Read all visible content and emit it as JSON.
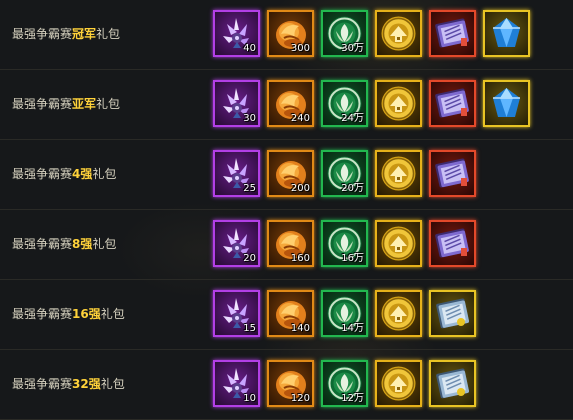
{
  "colors": {
    "label": "#d8d3c0",
    "highlight": "#ffd23a"
  },
  "icons": [
    "crystal-flower-icon",
    "fire-scroll-icon",
    "jade-coin-icon",
    "gold-coin-icon",
    "skill-book-icon",
    "sapphire-gem-icon"
  ],
  "rows": [
    {
      "label_prefix": "最强争霸赛",
      "label_highlight": "冠军",
      "label_suffix": "礼包",
      "items": [
        {
          "icon": "crystal-flower-icon",
          "qty": "40"
        },
        {
          "icon": "fire-scroll-icon",
          "qty": "300"
        },
        {
          "icon": "jade-coin-icon",
          "qty": "30万"
        },
        {
          "icon": "gold-coin-icon",
          "qty": ""
        },
        {
          "icon": "skill-book-icon",
          "qty": ""
        },
        {
          "icon": "sapphire-gem-icon",
          "qty": ""
        }
      ]
    },
    {
      "label_prefix": "最强争霸赛",
      "label_highlight": "亚军",
      "label_suffix": "礼包",
      "items": [
        {
          "icon": "crystal-flower-icon",
          "qty": "30"
        },
        {
          "icon": "fire-scroll-icon",
          "qty": "240"
        },
        {
          "icon": "jade-coin-icon",
          "qty": "24万"
        },
        {
          "icon": "gold-coin-icon",
          "qty": ""
        },
        {
          "icon": "skill-book-icon",
          "qty": ""
        },
        {
          "icon": "sapphire-gem-icon",
          "qty": ""
        }
      ]
    },
    {
      "label_prefix": "最强争霸赛",
      "label_highlight": "4强",
      "label_suffix": "礼包",
      "items": [
        {
          "icon": "crystal-flower-icon",
          "qty": "25"
        },
        {
          "icon": "fire-scroll-icon",
          "qty": "200"
        },
        {
          "icon": "jade-coin-icon",
          "qty": "20万"
        },
        {
          "icon": "gold-coin-icon",
          "qty": ""
        },
        {
          "icon": "skill-book-icon",
          "qty": ""
        }
      ]
    },
    {
      "label_prefix": "最强争霸赛",
      "label_highlight": "8强",
      "label_suffix": "礼包",
      "items": [
        {
          "icon": "crystal-flower-icon",
          "qty": "20"
        },
        {
          "icon": "fire-scroll-icon",
          "qty": "160"
        },
        {
          "icon": "jade-coin-icon",
          "qty": "16万"
        },
        {
          "icon": "gold-coin-icon",
          "qty": ""
        },
        {
          "icon": "skill-book-icon",
          "qty": ""
        }
      ]
    },
    {
      "label_prefix": "最强争霸赛",
      "label_highlight": "16强",
      "label_suffix": "礼包",
      "items": [
        {
          "icon": "crystal-flower-icon",
          "qty": "15"
        },
        {
          "icon": "fire-scroll-icon",
          "qty": "140"
        },
        {
          "icon": "jade-coin-icon",
          "qty": "14万"
        },
        {
          "icon": "gold-coin-icon",
          "qty": ""
        },
        {
          "icon": "blue-book-icon",
          "qty": ""
        }
      ]
    },
    {
      "label_prefix": "最强争霸赛",
      "label_highlight": "32强",
      "label_suffix": "礼包",
      "items": [
        {
          "icon": "crystal-flower-icon",
          "qty": "10"
        },
        {
          "icon": "fire-scroll-icon",
          "qty": "120"
        },
        {
          "icon": "jade-coin-icon",
          "qty": "12万"
        },
        {
          "icon": "gold-coin-icon",
          "qty": ""
        },
        {
          "icon": "blue-book-icon",
          "qty": ""
        }
      ]
    }
  ]
}
